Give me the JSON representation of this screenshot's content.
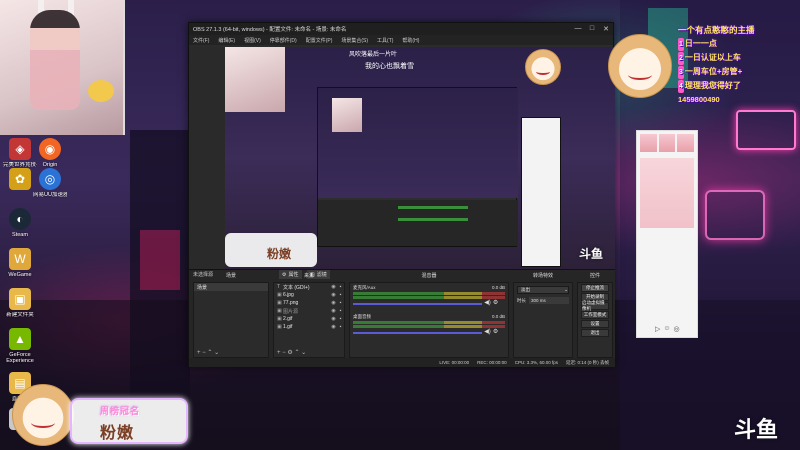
{
  "desktop": {
    "icons": [
      {
        "label": "完美世界竞技平台",
        "glyph": "◈",
        "color": "#c23636"
      },
      {
        "label": "Origin",
        "glyph": "◉",
        "color": "#f26522"
      },
      {
        "label": "",
        "glyph": "✿",
        "color": "#d4a017"
      },
      {
        "label": "网易UU加速器",
        "glyph": "◎",
        "color": "#2a72d6"
      },
      {
        "label": "Steam",
        "glyph": "◐",
        "color": "#1b2838"
      },
      {
        "label": "WeGame",
        "glyph": "W",
        "color": "#e0a83b"
      },
      {
        "label": "新建文件夹",
        "glyph": "▣",
        "color": "#e8b84a"
      },
      {
        "label": "GeForce Experience",
        "glyph": "▲",
        "color": "#76b900"
      },
      {
        "label": "直播姬",
        "glyph": "▤",
        "color": "#e8b84a"
      },
      {
        "label": "",
        "glyph": "▦",
        "color": "#c8c8c8"
      }
    ]
  },
  "obs": {
    "title": "OBS 27.1.3 (64-bit, windows) - 配置文件: 未命名 - 场景: 未命名",
    "preview_title": "风吹落最后一片叶",
    "preview_subtitle": "我的心也飘着雪",
    "menu": [
      "文件(F)",
      "编辑(E)",
      "视图(V)",
      "停靠部件(D)",
      "配置文件(P)",
      "场景集合(S)",
      "工具(T)",
      "帮助(H)"
    ],
    "window_controls": [
      "—",
      "□",
      "✕"
    ],
    "preview_label_left": "未选择源",
    "preview_btn_props": "属性",
    "preview_btn_filters": "滤镜",
    "docks": {
      "scenes_header": "场景",
      "sources_header": "来源",
      "mixer_header": "混音器",
      "transitions_header": "转场特效",
      "controls_header": "控件",
      "scene_items": [
        "场景"
      ],
      "sources": [
        {
          "icon": "T",
          "name": "文本 (GDI+)"
        },
        {
          "icon": "▣",
          "name": "6.jpg"
        },
        {
          "icon": "▣",
          "name": "77.png"
        },
        {
          "icon": "▣",
          "name": "图片源"
        },
        {
          "icon": "▣",
          "name": "2.gif"
        },
        {
          "icon": "▣",
          "name": "1.gif"
        }
      ],
      "mixer": [
        {
          "name": "麦克风/Aux",
          "db": "0.0 dB"
        },
        {
          "name": "桌面音频",
          "db": "0.0 dB"
        }
      ],
      "transition_type": "淡出",
      "transition_duration_label": "时长",
      "transition_duration": "300 ms",
      "controls": [
        "停止推流",
        "开始录制",
        "启动虚拟摄像机",
        "工作室模式",
        "设置",
        "退出"
      ]
    },
    "status": {
      "live": "LIVE: 00:00:00",
      "rec": "REC: 00:00:00",
      "cpu": "CPU: 3.3%, 60.00 fps",
      "bitrate": "延迟: 0:14 (0 秒) 丢帧"
    }
  },
  "danmu": {
    "title": "一个有点憨憨的主播",
    "lines": [
      {
        "num": "1",
        "text": "日一一点"
      },
      {
        "num": "2",
        "text": "一日认证以上车"
      },
      {
        "num": "3",
        "text": "一周车位+房管+"
      },
      {
        "num": "4",
        "text": "理理我您得好了"
      }
    ],
    "qq": "1459800490"
  },
  "badge": {
    "title": "周榜冠名",
    "name": "粉嫩"
  },
  "overlay_small_name": "粉嫩",
  "watermark": "斗鱼",
  "colors": {
    "neon_pink": "#ff5fbf",
    "neon_green": "#35e0a0",
    "obs_bg": "#2b2b2b",
    "danmu_yellow": "#ffe65c"
  }
}
